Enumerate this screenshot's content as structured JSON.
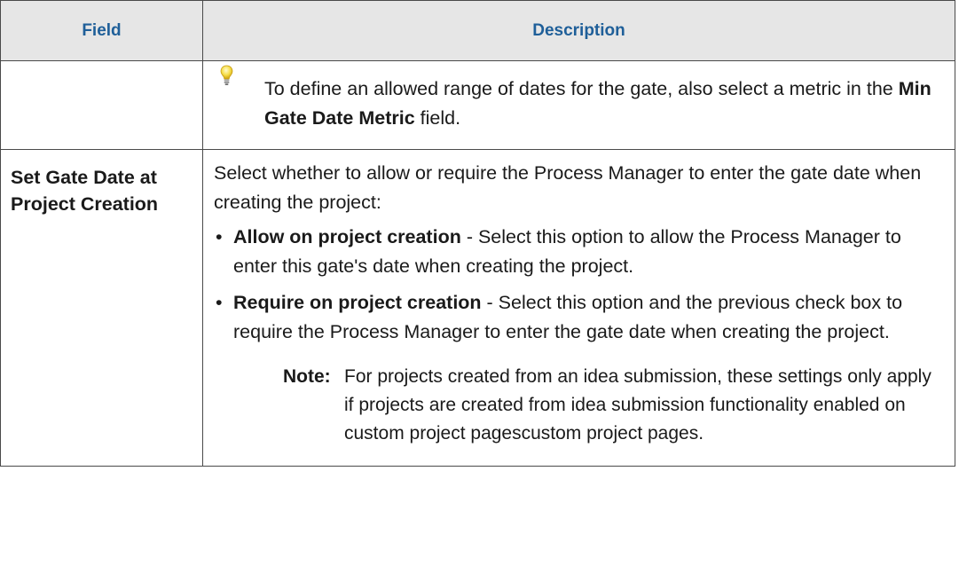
{
  "table": {
    "headers": {
      "field": "Field",
      "description": "Description"
    },
    "tip_row": {
      "icon": "lightbulb-icon",
      "text_before": "To define an allowed range of dates for the gate, also select a metric in the ",
      "text_bold": "Min Gate Date Metric",
      "text_after": " field."
    },
    "gate_row": {
      "field_line1": "Set Gate Date at",
      "field_line2": "Project Creation",
      "intro": "Select whether to allow or require the Process Manager to enter the gate date when creating the project:",
      "options": [
        {
          "bullet": "•",
          "label": "Allow on project creation",
          "text": " - Select this option to allow the Process Manager to enter this gate's date when creating the project."
        },
        {
          "bullet": "•",
          "label": "Require on project creation",
          "text": " - Select this option and the previous check box to require the Process Manager to enter the gate date when creating the project."
        }
      ],
      "note_label": "Note:",
      "note_text": "For projects created from an idea submission, these settings only apply if projects are created from idea submission functionality enabled on custom project pagescustom project pages."
    }
  }
}
